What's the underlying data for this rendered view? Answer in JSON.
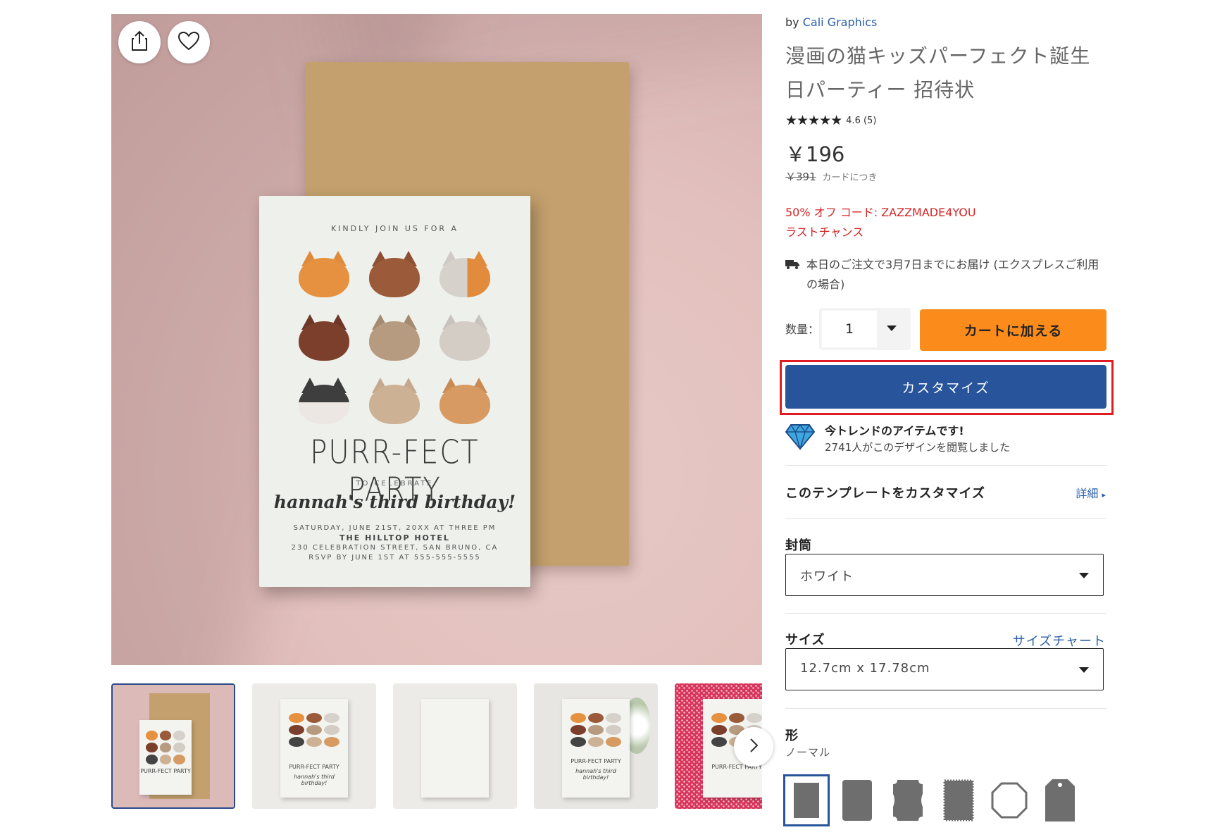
{
  "gallery": {
    "main_card": {
      "kindly": "KINDLY JOIN US FOR A",
      "title": "PURR-FECT PARTY",
      "to_celebrate": "TO CELEBRATE",
      "script": "hannah's third birthday!",
      "line1": "SATURDAY, JUNE 21ST, 20XX AT THREE PM",
      "line2": "THE HILLTOP HOTEL",
      "line3": "230 CELEBRATION STREET, SAN BRUNO, CA",
      "line4": "RSVP BY JUNE 1ST AT 555-555-5555"
    },
    "share_icon": "share-icon",
    "favorite_icon": "heart-icon",
    "thumbnails": [
      {
        "kind": "mockup-kraft",
        "selected": true
      },
      {
        "kind": "card-front",
        "selected": false
      },
      {
        "kind": "card-back-pattern",
        "selected": false
      },
      {
        "kind": "card-flowers",
        "selected": false
      },
      {
        "kind": "card-on-pattern",
        "selected": false
      }
    ],
    "thumb_title": "PURR-FECT PARTY",
    "thumb_script": "hannah's third birthday!",
    "next_icon": "chevron-right-icon"
  },
  "product": {
    "by_prefix": "by",
    "brand": "Cali Graphics",
    "title_line1": "漫画の猫キッズパーフェクト誕生",
    "title_line2": "日パーティー 招待状",
    "stars": "★★★★★",
    "rating_value": 4.6,
    "rating_text": "4.6 (5)",
    "price": "￥196",
    "original_price": "￥391",
    "per_unit": "カードにつき",
    "promo_line1": "50% オフ コード: ZAZZMADE4YOU",
    "promo_line2": "ラストチャンス",
    "delivery": "本日のご注文で3月7日までにお届け (エクスプレスご利用の場合)",
    "quantity_label": "数量：",
    "quantity_value": "1",
    "add_to_cart": "カートに加える",
    "customize": "カスタマイズ",
    "trend_title": "今トレンドのアイテムです!",
    "trend_sub": "2741人がこのデザインを閲覧しました",
    "customize_template": "このテンプレートをカスタマイズ",
    "details_link": "詳細",
    "envelope_label": "封筒",
    "envelope_value": "ホワイト",
    "size_label": "サイズ",
    "size_chart": "サイズチャート",
    "size_value": "12.7cm x 17.78cm",
    "shape_label": "形",
    "shape_value": "ノーマル",
    "shapes": [
      "rectangle",
      "rounded",
      "ticket",
      "scalloped",
      "octagon",
      "tag"
    ]
  },
  "colors": {
    "accent_blue": "#27549a",
    "cart_orange": "#fb8c1c",
    "promo_red": "#d32323",
    "highlight_red": "#e11b22",
    "link_blue": "#2b5ea8"
  }
}
